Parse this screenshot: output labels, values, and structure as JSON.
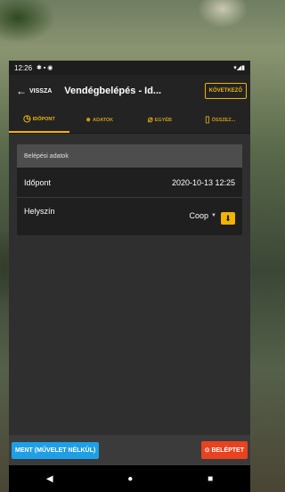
{
  "statusbar": {
    "time": "12:26",
    "icons_left": "✱ ▪ ◉",
    "icons_right": "▾◢▮"
  },
  "appbar": {
    "back_label": "VISSZA",
    "title": "Vendégbelépés - Id...",
    "next_label": "KÖVETKEZŐ"
  },
  "tabs": [
    {
      "label": "IDŐPONT",
      "icon": "clock-icon",
      "glyph": "◷",
      "active": true
    },
    {
      "label": "ADATOK",
      "icon": "person-icon",
      "glyph": "👤",
      "active": false
    },
    {
      "label": "EGYÉB",
      "icon": "paperclip-icon",
      "glyph": "📎",
      "active": false
    },
    {
      "label": "ÖSSZEZ...",
      "icon": "summary-icon",
      "glyph": "📖",
      "active": false
    }
  ],
  "card": {
    "header": "Belépési adatok",
    "rows": [
      {
        "label": "Időpont",
        "value": "2020-10-13 12:25"
      },
      {
        "label": "Helyszín",
        "value": "Coop"
      }
    ]
  },
  "buttons": {
    "save_label": "MENT (MŰVELET NÉLKÜL)",
    "enter_label": "BELÉPTET"
  },
  "navbar": {
    "back": "◀",
    "home": "●",
    "recents": "■"
  },
  "colors": {
    "accent": "#f0b400",
    "save": "#1fa0e6",
    "enter": "#e8421f"
  }
}
